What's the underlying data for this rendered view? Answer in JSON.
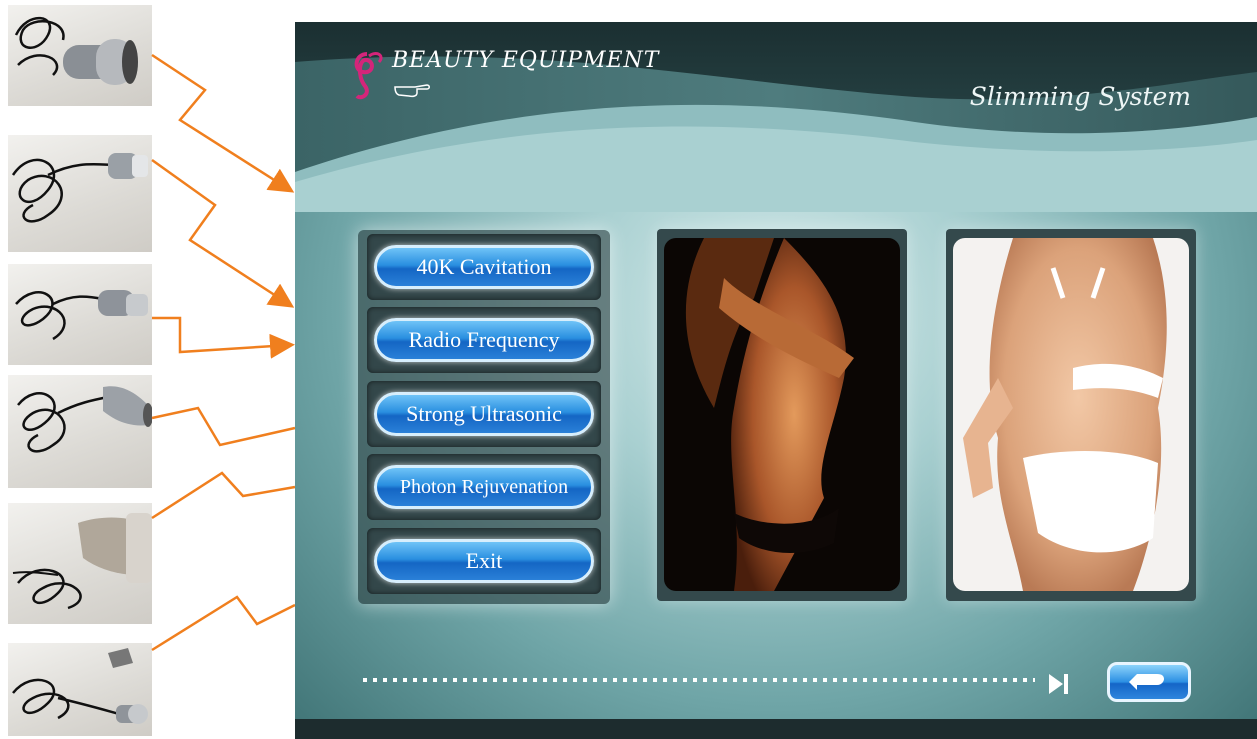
{
  "screen": {
    "brand": "BEAUTY EQUIPMENT",
    "subtitle": "Slimming System"
  },
  "menu": {
    "items": [
      {
        "label": "40K Cavitation"
      },
      {
        "label": "Radio Frequency"
      },
      {
        "label": "Strong Ultrasonic"
      },
      {
        "label": "Photon Rejuvenation"
      },
      {
        "label": "Exit"
      }
    ]
  },
  "colors": {
    "connector": "#f07f1e",
    "button_blue": "#2a8fe0",
    "screen_teal": "#6fa5a7",
    "header_dark": "#1f3638"
  },
  "icons": {
    "brand_logo": "swirl-logo-icon",
    "pointer": "pointing-hand-icon",
    "skip_end": "skip-to-end-icon",
    "back": "return-arrow-icon"
  },
  "handpieces": [
    {
      "name": "cavitation-handpiece"
    },
    {
      "name": "rf-handpiece-small"
    },
    {
      "name": "rf-handpiece-tripolar"
    },
    {
      "name": "ultrasonic-handpiece"
    },
    {
      "name": "photon-handpiece"
    },
    {
      "name": "eye-rf-handpiece"
    }
  ]
}
